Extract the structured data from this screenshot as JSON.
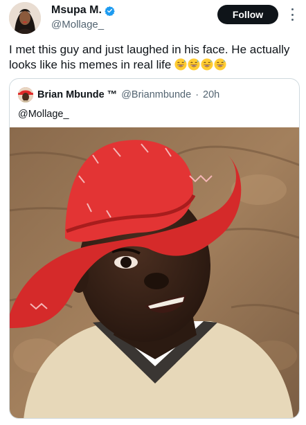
{
  "author": {
    "name": "Msupa M.",
    "handle": "@Mollage_",
    "verified": true,
    "avatar_icon": "profile-photo"
  },
  "follow_button": {
    "label": "Follow"
  },
  "tweet": {
    "text": "I met this guy and just laughed in his face. He actually looks like his memes in real life",
    "emoji_icon": "grinning-sweat-face",
    "emoji_count": 4
  },
  "quote": {
    "author_name": "Brian Mbunde ™",
    "handle": "@Brianmbunde",
    "separator": "·",
    "time": "20h",
    "text": "@Mollage_",
    "media_icon": "photo-man-in-red-hat"
  },
  "colors": {
    "accent_verified": "#1d9bf0",
    "follow_bg": "#0f1419",
    "secondary_text": "#536471",
    "border": "#cfd9de",
    "hat_red": "#e02a2a"
  }
}
